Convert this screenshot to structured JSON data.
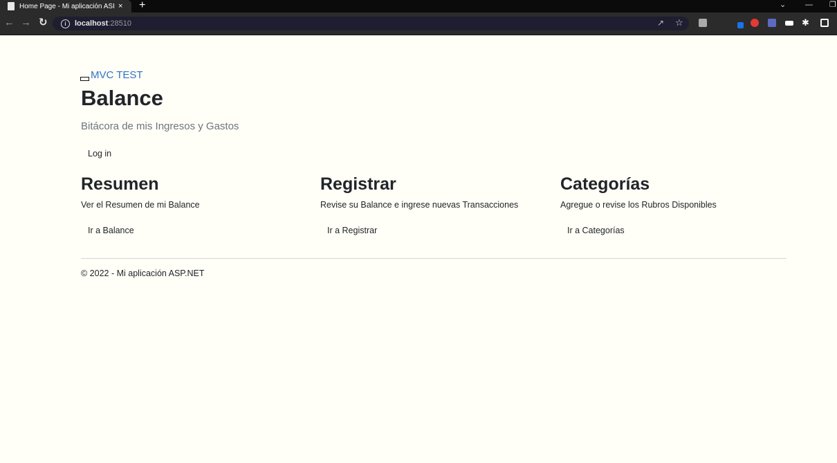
{
  "browser": {
    "tab_title": "Home Page - Mi aplicación ASP.N",
    "tab_close": "×",
    "new_tab": "+",
    "address_host": "localhost",
    "address_port": ":28510"
  },
  "page": {
    "brand": "MVC TEST",
    "title": "Balance",
    "subtitle": "Bitácora de mis Ingresos y Gastos",
    "login_button": "Log in",
    "sections": [
      {
        "heading": "Resumen",
        "description": "Ver el Resumen de mi Balance",
        "button": "Ir a Balance"
      },
      {
        "heading": "Registrar",
        "description": "Revise su Balance e ingrese nuevas Transacciones",
        "button": "Ir a Registrar"
      },
      {
        "heading": "Categorías",
        "description": "Agregue o revise los Rubros Disponibles",
        "button": "Ir a Categorías"
      }
    ],
    "footer": "© 2022 - Mi aplicación ASP.NET"
  },
  "colors": {
    "background": "#fffef7",
    "brand_link": "#2f73c8",
    "text": "#212529",
    "muted": "#6c757d"
  }
}
